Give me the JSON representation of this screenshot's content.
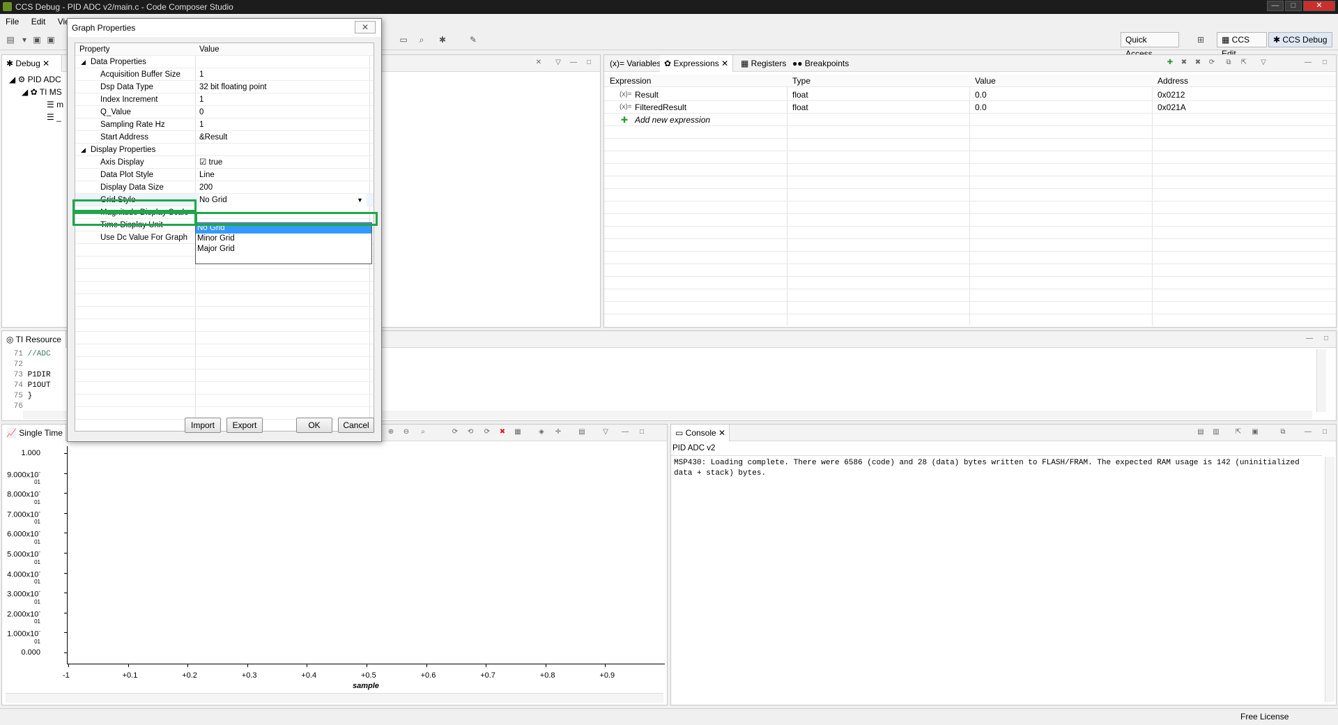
{
  "window": {
    "title": "CCS Debug - PID ADC v2/main.c - Code Composer Studio",
    "min": "—",
    "max": "□",
    "close": "✕"
  },
  "menu": [
    "File",
    "Edit",
    "Vie"
  ],
  "toolbar": {
    "quick_access": "Quick Access",
    "ccs_edit": "CCS Edit",
    "ccs_debug": "CCS Debug"
  },
  "debug_view": {
    "tab": "Debug",
    "tree": [
      "PID ADC",
      "TI MS",
      "m",
      "_"
    ]
  },
  "resource_view": {
    "tab": "TI Resource"
  },
  "code": {
    "lines": [
      {
        "num": "71",
        "text": "  //ADC"
      },
      {
        "num": "72",
        "text": ""
      },
      {
        "num": "73",
        "text": "  P1DIR"
      },
      {
        "num": "74",
        "text": "  P1OUT"
      },
      {
        "num": "75",
        "text": "}"
      },
      {
        "num": "76",
        "text": ""
      }
    ]
  },
  "expressions": {
    "tabs": [
      "Variables",
      "Expressions",
      "Registers",
      "Breakpoints"
    ],
    "columns": [
      "Expression",
      "Type",
      "Value",
      "Address"
    ],
    "rows": [
      {
        "expr": "Result",
        "type": "float",
        "value": "0.0",
        "address": "0x0212"
      },
      {
        "expr": "FilteredResult",
        "type": "float",
        "value": "0.0",
        "address": "0x021A"
      }
    ],
    "add": "Add new expression"
  },
  "graph": {
    "tab": "Single Time",
    "ylabels": [
      "1.000",
      "9.000x10",
      "8.000x10",
      "7.000x10",
      "6.000x10",
      "5.000x10",
      "4.000x10",
      "3.000x10",
      "2.000x10",
      "1.000x10",
      "0.000"
    ],
    "exp": "-01",
    "xlabels": [
      "-1",
      "+0.1",
      "+0.2",
      "+0.3",
      "+0.4",
      "+0.5",
      "+0.6",
      "+0.7",
      "+0.8",
      "+0.9"
    ],
    "xaxis": "sample"
  },
  "console": {
    "tab": "Console",
    "subtitle": "PID ADC v2",
    "text": "MSP430: Loading complete. There were 6586 (code) and 28 (data) bytes written to FLASH/FRAM. The expected RAM usage is 142 (uninitialized data + stack) bytes."
  },
  "status": {
    "license": "Free License"
  },
  "dialog": {
    "title": "Graph Properties",
    "columns": [
      "Property",
      "Value"
    ],
    "groups": [
      {
        "name": "Data Properties",
        "items": [
          {
            "p": "Acquisition Buffer Size",
            "v": "1"
          },
          {
            "p": "Dsp Data Type",
            "v": "32 bit floating point"
          },
          {
            "p": "Index Increment",
            "v": "1"
          },
          {
            "p": "Q_Value",
            "v": "0"
          },
          {
            "p": "Sampling Rate Hz",
            "v": "1"
          },
          {
            "p": "Start Address",
            "v": "&Result"
          }
        ]
      },
      {
        "name": "Display Properties",
        "items": [
          {
            "p": "Axis Display",
            "v": "true"
          },
          {
            "p": "Data Plot Style",
            "v": "Line"
          },
          {
            "p": "Display Data Size",
            "v": "200"
          },
          {
            "p": "Grid Style",
            "v": "No Grid"
          },
          {
            "p": "Magnitude Display Scale",
            "v": ""
          },
          {
            "p": "Time Display Unit",
            "v": ""
          },
          {
            "p": "Use Dc Value For Graph",
            "v": ""
          }
        ]
      }
    ],
    "dropdown_options": [
      "No Grid",
      "Minor Grid",
      "Major Grid"
    ],
    "buttons": {
      "import": "Import",
      "export": "Export",
      "ok": "OK",
      "cancel": "Cancel"
    }
  }
}
